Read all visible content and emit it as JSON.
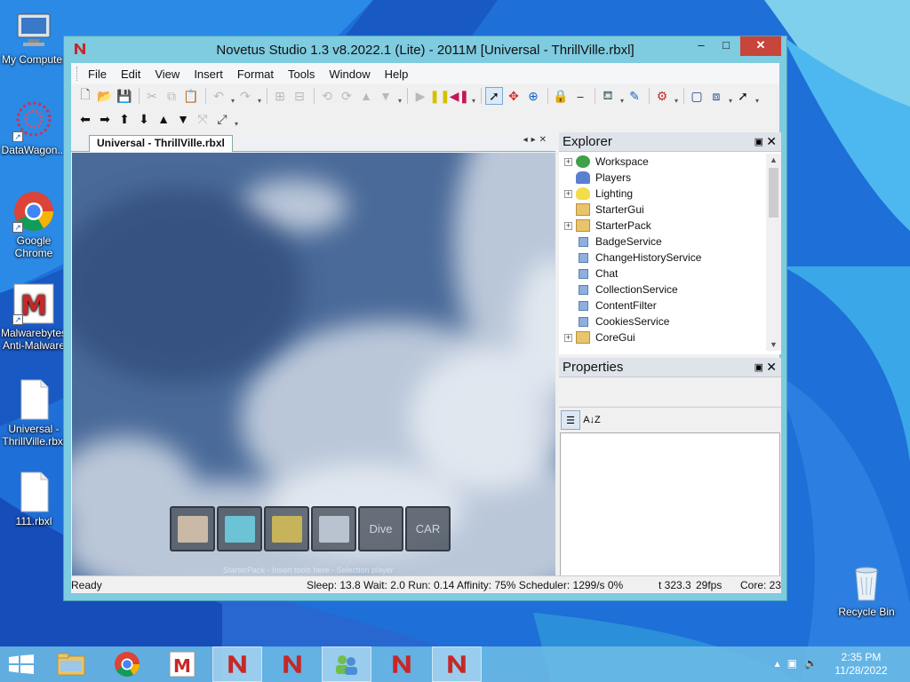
{
  "desktop": {
    "icons": [
      {
        "label": "My Computer",
        "icon": "computer-icon"
      },
      {
        "label": "DataWagon...",
        "icon": "datawagon-icon"
      },
      {
        "label": "Google Chrome",
        "icon": "chrome-icon"
      },
      {
        "label": "Malwarebytes Anti-Malware",
        "icon": "malwarebytes-icon"
      },
      {
        "label": "Universal - ThrillVille.rbxl",
        "icon": "file-icon"
      },
      {
        "label": "111.rbxl",
        "icon": "file-icon"
      },
      {
        "label": "Recycle Bin",
        "icon": "recycle-bin-icon"
      }
    ]
  },
  "window": {
    "title": "Novetus Studio 1.3 v8.2022.1 (Lite) - 2011M [Universal - ThrillVille.rbxl]",
    "minimize": "–",
    "maximize": "□",
    "close": "✕"
  },
  "menu": [
    "File",
    "Edit",
    "View",
    "Insert",
    "Format",
    "Tools",
    "Window",
    "Help"
  ],
  "document": {
    "tab_label": "Universal - ThrillVille.rbxl",
    "tab_nav": "◂▸✕",
    "hotbar": [
      {
        "label": "",
        "kind": "brick",
        "color": "#c9b9a6"
      },
      {
        "label": "",
        "kind": "paint",
        "color": "#6cc3d5"
      },
      {
        "label": "",
        "kind": "tool",
        "color": "#c7b45a"
      },
      {
        "label": "",
        "kind": "hammer",
        "color": "#b9c3cf"
      },
      {
        "label": "Dive",
        "kind": "text"
      },
      {
        "label": "CAR",
        "kind": "text"
      }
    ],
    "viewport_hint": "StarterPack - Insert tools here - Selection player"
  },
  "explorer": {
    "title": "Explorer",
    "items": [
      {
        "label": "Workspace",
        "expandable": true,
        "icon": "globe-icon"
      },
      {
        "label": "Players",
        "expandable": false,
        "icon": "players-icon"
      },
      {
        "label": "Lighting",
        "expandable": true,
        "icon": "lightbulb-icon"
      },
      {
        "label": "StarterGui",
        "expandable": false,
        "icon": "folder-icon"
      },
      {
        "label": "StarterPack",
        "expandable": true,
        "icon": "folder-icon"
      },
      {
        "label": "BadgeService",
        "expandable": false,
        "icon": "service-icon"
      },
      {
        "label": "ChangeHistoryService",
        "expandable": false,
        "icon": "service-icon"
      },
      {
        "label": "Chat",
        "expandable": false,
        "icon": "service-icon"
      },
      {
        "label": "CollectionService",
        "expandable": false,
        "icon": "service-icon"
      },
      {
        "label": "ContentFilter",
        "expandable": false,
        "icon": "service-icon"
      },
      {
        "label": "CookiesService",
        "expandable": false,
        "icon": "service-icon"
      },
      {
        "label": "CoreGui",
        "expandable": true,
        "icon": "folder-icon"
      }
    ]
  },
  "properties": {
    "title": "Properties",
    "categorized_label": "☰",
    "alphabetical_label": "A↓Z"
  },
  "panel_pin": "▣",
  "panel_close": "✕",
  "status": {
    "ready": "Ready",
    "stats": "Sleep: 13.8 Wait: 2.0 Run: 0.14 Affinity: 75% Scheduler: 1299/s 0%",
    "time": "t 323.3",
    "fps": "29fps",
    "cores": "Core: 23"
  },
  "taskbar": {
    "clock_time": "2:35 PM",
    "clock_date": "11/28/2022"
  },
  "colors": {
    "window_frame": "#7fcbe0",
    "close_button": "#c7453a",
    "taskbar": "#6ebee6"
  }
}
